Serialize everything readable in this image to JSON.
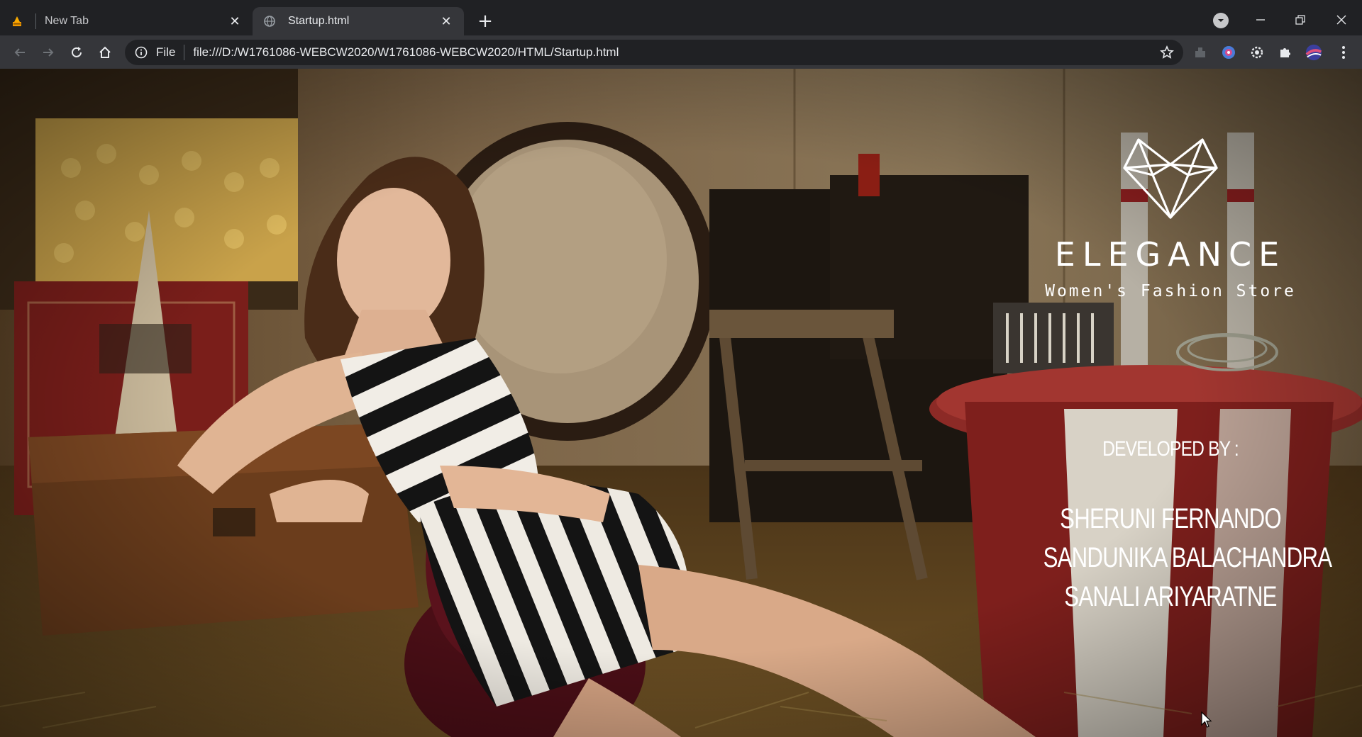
{
  "browser": {
    "tabs": [
      {
        "title": "New Tab",
        "active": false,
        "icon": "app-favicon"
      },
      {
        "title": "Startup.html",
        "active": true,
        "icon": "globe-icon"
      }
    ],
    "new_tab_label": "+",
    "close_glyph": "✕",
    "address": {
      "scheme_label": "File",
      "url": "file:///D:/W1761086-WEBCW2020/W1761086-WEBCW2020/HTML/Startup.html"
    }
  },
  "page": {
    "brand": {
      "name": "ELEGANCE",
      "tagline": "Women's Fashion Store"
    },
    "credits": {
      "title": "DEVELOPED BY :",
      "developers": [
        "SHERUNI FERNANDO",
        "SANDUNIKA BALACHANDRA",
        "SANALI ARIYARATNE"
      ]
    }
  },
  "colors": {
    "chrome_dark": "#202124",
    "chrome_toolbar": "#35363a",
    "text_light": "#e8eaed",
    "brand_text": "#ffffff"
  }
}
